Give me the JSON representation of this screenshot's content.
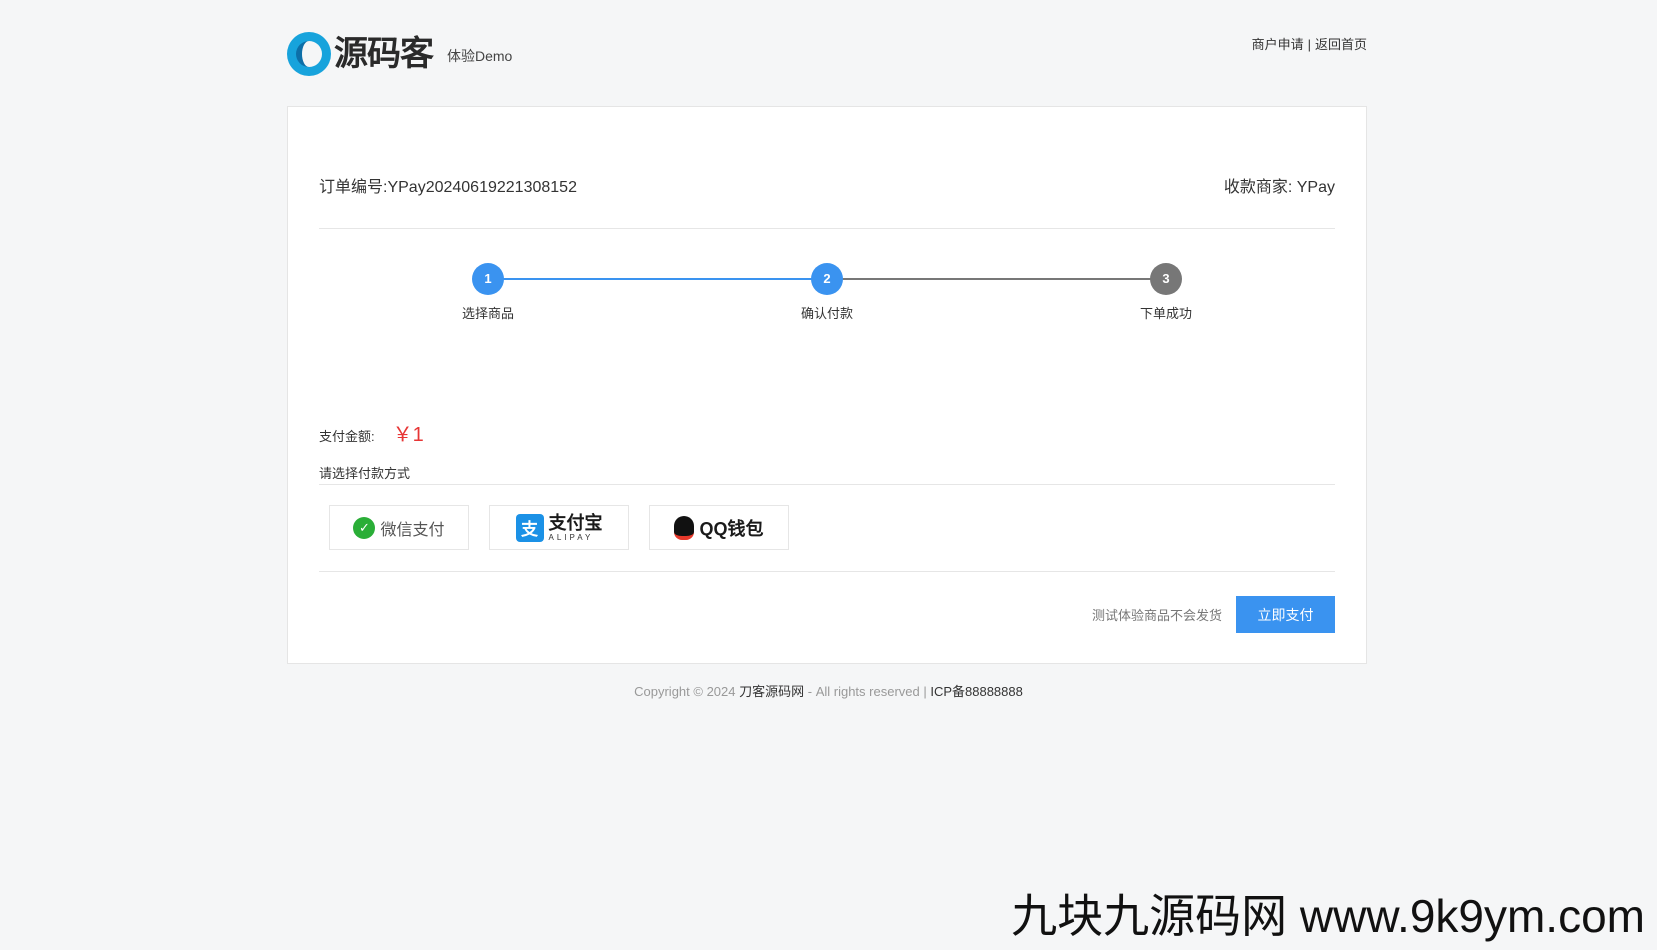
{
  "header": {
    "logo_text": "源码客",
    "logo_subtitle": "体验Demo",
    "links": [
      {
        "label": "商户申请"
      },
      {
        "label": "返回首页"
      }
    ],
    "separator": "|"
  },
  "order": {
    "number_text": "订单编号:YPay20240619221308152",
    "merchant_text": "收款商家: YPay"
  },
  "steps": [
    {
      "number": "1",
      "label": "选择商品",
      "state": "active"
    },
    {
      "number": "2",
      "label": "确认付款",
      "state": "active"
    },
    {
      "number": "3",
      "label": "下单成功",
      "state": "inactive"
    }
  ],
  "payment": {
    "amount_label": "支付金额:",
    "amount_value": "￥1",
    "method_title": "请选择付款方式",
    "methods": [
      {
        "name": "wechat",
        "label": "微信支付",
        "icon": "wechat-icon",
        "color": "#2aae37"
      },
      {
        "name": "alipay",
        "label": "支付宝",
        "sub": "ALIPAY",
        "icon": "alipay-icon",
        "color": "#1b91e6"
      },
      {
        "name": "qq",
        "label": "QQ钱包",
        "icon": "qq-penguin-icon",
        "color": "#111111"
      }
    ]
  },
  "action": {
    "note": "测试体验商品不会发货",
    "button_label": "立即支付"
  },
  "footer": {
    "copyright": "Copyright © 2024",
    "site_name": "刀客源码网",
    "rights": "- All rights reserved |",
    "icp": "ICP备88888888"
  },
  "watermark": "九块九源码网 www.9k9ym.com",
  "colors": {
    "primary": "#3a93f0",
    "price": "#e73535",
    "inactive_step": "#777777",
    "background": "#f5f6f7"
  }
}
